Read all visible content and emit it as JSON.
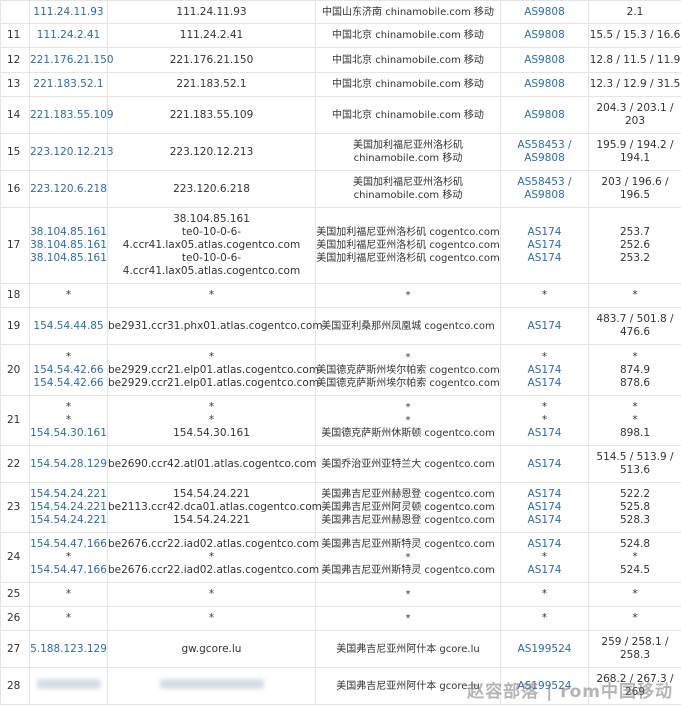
{
  "rows": [
    {
      "hop": "",
      "ips": [
        "111.24.11.93"
      ],
      "hosts": [
        "111.24.11.93"
      ],
      "locs": [
        "中国山东济南 chinamobile.com 移动"
      ],
      "asns": [
        "AS9808"
      ],
      "lats": [
        "2.1"
      ],
      "h": 23
    },
    {
      "hop": "11",
      "ips": [
        "111.24.2.41"
      ],
      "hosts": [
        "111.24.2.41"
      ],
      "locs": [
        "中国北京 chinamobile.com 移动"
      ],
      "asns": [
        "AS9808"
      ],
      "lats": [
        "15.5 / 15.3 / 16.6"
      ],
      "h": 24
    },
    {
      "hop": "12",
      "ips": [
        "221.176.21.150"
      ],
      "hosts": [
        "221.176.21.150"
      ],
      "locs": [
        "中国北京 chinamobile.com 移动"
      ],
      "asns": [
        "AS9808"
      ],
      "lats": [
        "12.8 / 11.5 / 11.9"
      ],
      "h": 25
    },
    {
      "hop": "13",
      "ips": [
        "221.183.52.1"
      ],
      "hosts": [
        "221.183.52.1"
      ],
      "locs": [
        "中国北京 chinamobile.com 移动"
      ],
      "asns": [
        "AS9808"
      ],
      "lats": [
        "12.3 / 12.9 / 31.5"
      ],
      "h": 24
    },
    {
      "hop": "14",
      "ips": [
        "221.183.55.109"
      ],
      "hosts": [
        "221.183.55.109"
      ],
      "locs": [
        "中国北京 chinamobile.com 移动"
      ],
      "asns": [
        "AS9808"
      ],
      "lats": [
        "204.3 / 203.1 /",
        "203"
      ],
      "h": 37
    },
    {
      "hop": "15",
      "ips": [
        "223.120.12.213"
      ],
      "hosts": [
        "223.120.12.213"
      ],
      "locs": [
        "美国加利福尼亚州洛杉矶",
        "chinamobile.com 移动"
      ],
      "asns": [
        "AS58453 /",
        "AS9808"
      ],
      "lats": [
        "195.9 / 194.2 /",
        "194.1"
      ],
      "h": 37
    },
    {
      "hop": "16",
      "ips": [
        "223.120.6.218"
      ],
      "hosts": [
        "223.120.6.218"
      ],
      "locs": [
        "美国加利福尼亚州洛杉矶",
        "chinamobile.com 移动"
      ],
      "asns": [
        "AS58453 /",
        "AS9808"
      ],
      "lats": [
        "203 / 196.6 /",
        "196.5"
      ],
      "h": 37
    },
    {
      "hop": "17",
      "ips": [
        "38.104.85.161",
        "38.104.85.161",
        "38.104.85.161"
      ],
      "hosts": [
        "38.104.85.161",
        "te0-10-0-6-",
        "4.ccr41.lax05.atlas.cogentco.com",
        "te0-10-0-6-",
        "4.ccr41.lax05.atlas.cogentco.com"
      ],
      "locs": [
        "美国加利福尼亚州洛杉矶 cogentco.com",
        "美国加利福尼亚州洛杉矶 cogentco.com",
        "美国加利福尼亚州洛杉矶 cogentco.com"
      ],
      "asns": [
        "AS174",
        "AS174",
        "AS174"
      ],
      "lats": [
        "253.7",
        "252.6",
        "253.2"
      ],
      "h": 76
    },
    {
      "hop": "18",
      "ips": [
        "*"
      ],
      "hosts": [
        "*"
      ],
      "locs": [
        "*"
      ],
      "asns": [
        "*"
      ],
      "lats": [
        "*"
      ],
      "h": 24
    },
    {
      "hop": "19",
      "ips": [
        "154.54.44.85"
      ],
      "hosts": [
        "be2931.ccr31.phx01.atlas.cogentco.com"
      ],
      "locs": [
        "美国亚利桑那州凤凰城 cogentco.com"
      ],
      "asns": [
        "AS174"
      ],
      "lats": [
        "483.7 / 501.8 /",
        "476.6"
      ],
      "h": 37
    },
    {
      "hop": "20",
      "ips": [
        "*",
        "154.54.42.66",
        "154.54.42.66"
      ],
      "hosts": [
        "*",
        "be2929.ccr21.elp01.atlas.cogentco.com",
        "be2929.ccr21.elp01.atlas.cogentco.com"
      ],
      "locs": [
        "*",
        "美国德克萨斯州埃尔帕索 cogentco.com",
        "美国德克萨斯州埃尔帕索 cogentco.com"
      ],
      "asns": [
        "*",
        "AS174",
        "AS174"
      ],
      "lats": [
        "*",
        "874.9",
        "878.6"
      ],
      "h": 51
    },
    {
      "hop": "21",
      "ips": [
        "*",
        "*",
        "154.54.30.161"
      ],
      "hosts": [
        "*",
        "*",
        "154.54.30.161"
      ],
      "locs": [
        "*",
        "*",
        "美国德克萨斯州休斯顿 cogentco.com"
      ],
      "asns": [
        "*",
        "*",
        "AS174"
      ],
      "lats": [
        "*",
        "*",
        "898.1"
      ],
      "h": 50
    },
    {
      "hop": "22",
      "ips": [
        "154.54.28.129"
      ],
      "hosts": [
        "be2690.ccr42.atl01.atlas.cogentco.com"
      ],
      "locs": [
        "美国乔治亚州亚特兰大 cogentco.com"
      ],
      "asns": [
        "AS174"
      ],
      "lats": [
        "514.5 / 513.9 /",
        "513.6"
      ],
      "h": 37
    },
    {
      "hop": "23",
      "ips": [
        "154.54.24.221",
        "154.54.24.221",
        "154.54.24.221"
      ],
      "hosts": [
        "154.54.24.221",
        "be2113.ccr42.dca01.atlas.cogentco.com",
        "154.54.24.221"
      ],
      "locs": [
        "美国弗吉尼亚州赫恩登 cogentco.com",
        "美国弗吉尼亚州阿灵顿 cogentco.com",
        "美国弗吉尼亚州赫恩登 cogentco.com"
      ],
      "asns": [
        "AS174",
        "AS174",
        "AS174"
      ],
      "lats": [
        "522.2",
        "525.8",
        "528.3"
      ],
      "h": 50
    },
    {
      "hop": "24",
      "ips": [
        "154.54.47.166",
        "*",
        "154.54.47.166"
      ],
      "hosts": [
        "be2676.ccr22.iad02.atlas.cogentco.com",
        "*",
        "be2676.ccr22.iad02.atlas.cogentco.com"
      ],
      "locs": [
        "美国弗吉尼亚州斯特灵 cogentco.com",
        "*",
        "美国弗吉尼亚州斯特灵 cogentco.com"
      ],
      "asns": [
        "AS174",
        "*",
        "AS174"
      ],
      "lats": [
        "524.8",
        "*",
        "524.5"
      ],
      "h": 50
    },
    {
      "hop": "25",
      "ips": [
        "*"
      ],
      "hosts": [
        "*"
      ],
      "locs": [
        "*"
      ],
      "asns": [
        "*"
      ],
      "lats": [
        "*"
      ],
      "h": 24
    },
    {
      "hop": "26",
      "ips": [
        "*"
      ],
      "hosts": [
        "*"
      ],
      "locs": [
        "*"
      ],
      "asns": [
        "*"
      ],
      "lats": [
        "*"
      ],
      "h": 24
    },
    {
      "hop": "27",
      "ips": [
        "5.188.123.129"
      ],
      "hosts": [
        "gw.gcore.lu"
      ],
      "locs": [
        "美国弗吉尼亚州阿什本 gcore.lu"
      ],
      "asns": [
        "AS199524"
      ],
      "lats": [
        "259 / 258.1 /",
        "258.3"
      ],
      "h": 37
    },
    {
      "hop": "28",
      "ips": [],
      "hosts": [],
      "locs": [
        "美国弗吉尼亚州阿什本 gcore.lu"
      ],
      "asns": [
        "AS199524"
      ],
      "lats": [
        "268.2 / 267.3 /",
        "269"
      ],
      "h": 37,
      "redacted": true
    }
  ],
  "watermark": "赵容部落 | rom中国移动"
}
